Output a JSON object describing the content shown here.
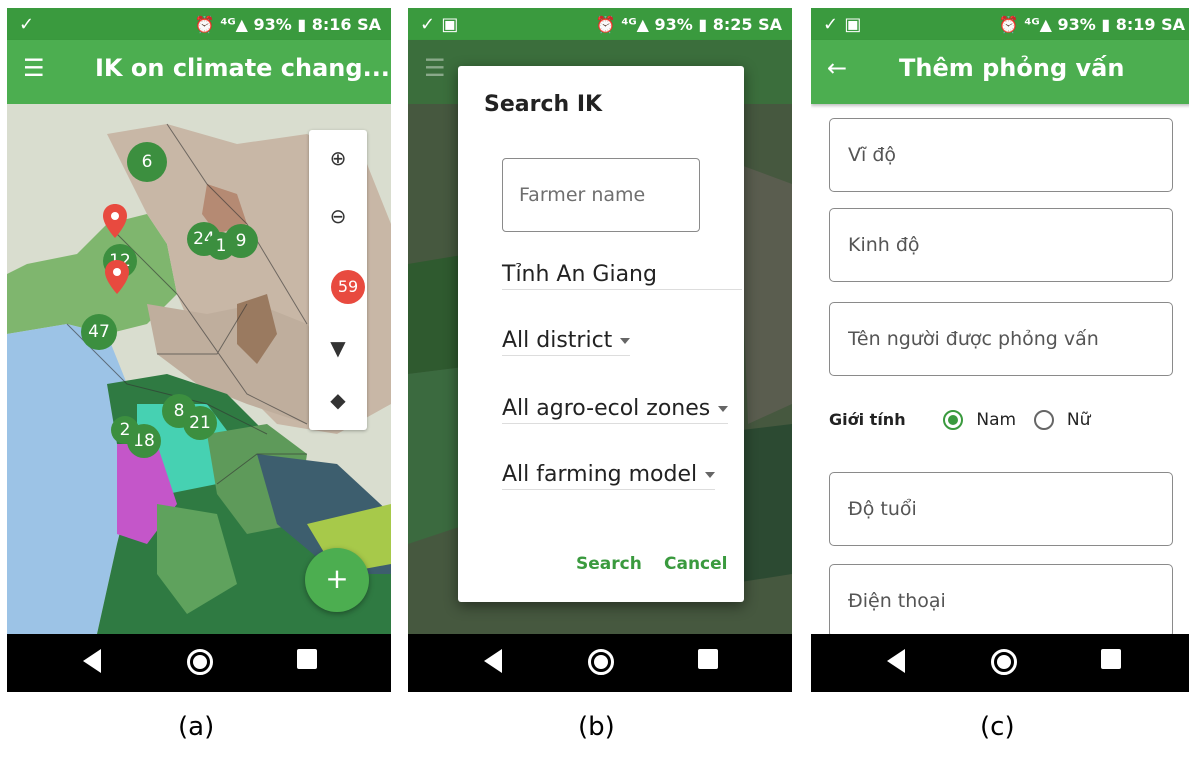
{
  "screens": {
    "a": {
      "status": {
        "icons_left": "✓",
        "right": "⏰ ⁴ᴳ▲ 93% ▮ 8:16 SA"
      },
      "title": "IK on climate chang...",
      "menu_icon": "hamburger-icon",
      "map_tools": {
        "zoom_in_icon": "zoom-in-icon",
        "zoom_out_icon": "zoom-out-icon",
        "count_badge": "59",
        "filter_icon": "filter-icon",
        "layers_icon": "layers-icon"
      },
      "clusters": [
        "6",
        "24",
        "1",
        "9",
        "12",
        "47",
        "8",
        "21",
        "18",
        "2"
      ],
      "fab_label": "+"
    },
    "b": {
      "status": {
        "icons_left": "✓ ▣",
        "right": "⏰ ⁴ᴳ▲ 93% ▮ 8:25 SA"
      },
      "dialog": {
        "title": "Search IK",
        "farmer_placeholder": "Farmer name",
        "province": "Tỉnh An Giang",
        "district": "All district",
        "zones": "All agro-ecol zones",
        "model": "All farming model",
        "search_label": "Search",
        "cancel_label": "Cancel"
      }
    },
    "c": {
      "status": {
        "icons_left": "✓ ▣",
        "right": "⏰ ⁴ᴳ▲ 93% ▮ 8:19 SA"
      },
      "title": "Thêm phỏng vấn",
      "fields": {
        "lat": "Vĩ độ",
        "lon": "Kinh độ",
        "name": "Tên người được phỏng vấn",
        "age": "Độ tuổi",
        "phone": "Điện thoại"
      },
      "gender": {
        "label": "Giới tính",
        "male": "Nam",
        "female": "Nữ"
      }
    }
  },
  "captions": [
    "(a)",
    "(b)",
    "(c)"
  ],
  "colors": {
    "primary": "#4cae50",
    "status": "#3a9a3e",
    "accent_text": "#3a9a3e",
    "marker_red": "#e84a3f"
  }
}
